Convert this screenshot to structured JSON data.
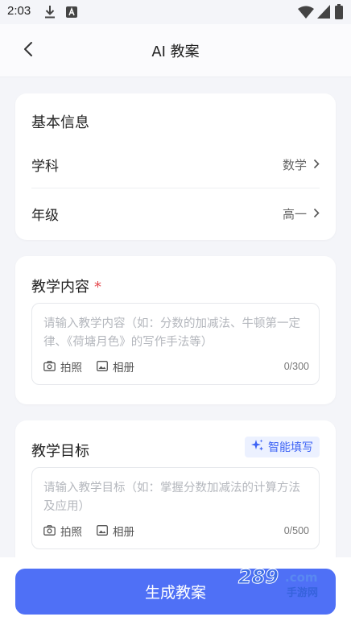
{
  "status_bar": {
    "time": "2:03",
    "icons": [
      "download-icon",
      "font-icon",
      "wifi-icon",
      "signal-icon",
      "battery-icon"
    ]
  },
  "header": {
    "title": "AI 教案",
    "back_icon": "chevron-left-icon"
  },
  "basic_info": {
    "title": "基本信息",
    "rows": [
      {
        "label": "学科",
        "value": "数学"
      },
      {
        "label": "年级",
        "value": "高一"
      }
    ]
  },
  "teaching_content": {
    "title": "教学内容",
    "required_mark": "*",
    "placeholder": "请输入教学内容（如：分数的加减法、牛顿第一定律、《荷塘月色》的写作手法等）",
    "photo_label": "拍照",
    "album_label": "相册",
    "counter": "0/300"
  },
  "teaching_goal": {
    "title": "教学目标",
    "smart_fill_label": "智能填写",
    "placeholder": "请输入教学目标（如：掌握分数加减法的计算方法及应用）",
    "photo_label": "拍照",
    "album_label": "相册",
    "counter": "0/500"
  },
  "bottom": {
    "generate_label": "生成教案"
  },
  "watermark": {
    "brand_number": "289",
    "brand_suffix": ".com",
    "brand_cn": "手游网"
  },
  "colors": {
    "accent": "#4f70f6",
    "required": "#e5484d",
    "smart_fill_bg": "#ecf1ff",
    "smart_fill_text": "#3d63f5",
    "background": "#f4f5f9"
  }
}
